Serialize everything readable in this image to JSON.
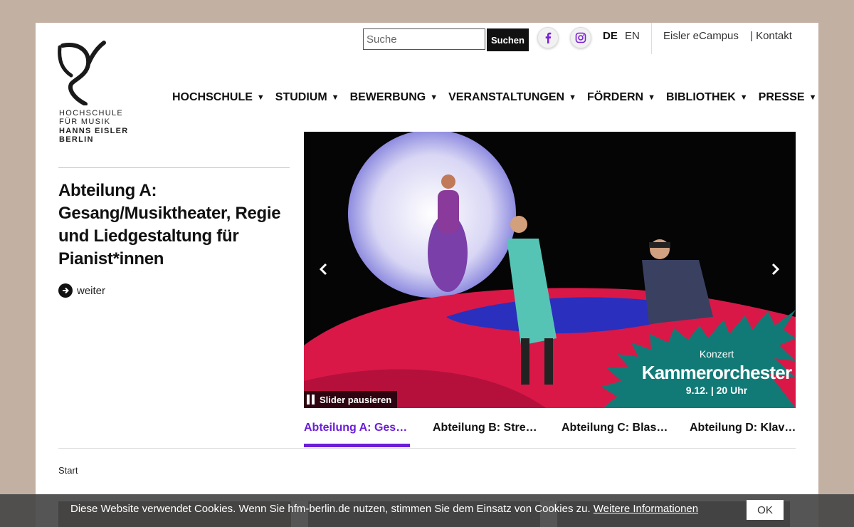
{
  "header": {
    "search": {
      "placeholder": "Suche",
      "value": "",
      "button": "Suchen"
    },
    "social": [
      "facebook-icon",
      "instagram-icon"
    ],
    "languages": [
      {
        "label": "DE",
        "active": true
      },
      {
        "label": "EN",
        "active": false
      }
    ],
    "links": [
      "Eisler eCampus",
      "| Kontakt"
    ]
  },
  "logo": {
    "line1": "HOCHSCHULE",
    "line2": "FÜR MUSIK",
    "line3": "HANNS EISLER",
    "line4": "BERLIN"
  },
  "nav": [
    "HOCHSCHULE",
    "STUDIUM",
    "BEWERBUNG",
    "VERANSTALTUNGEN",
    "FÖRDERN",
    "BIBLIOTHEK",
    "PRESSE"
  ],
  "teaser": {
    "title": "Abteilung A: Gesang/Musiktheater, Regie und Liedgestaltung für Pianist*innen",
    "more": "weiter"
  },
  "slider": {
    "pause_label": "Slider pausieren",
    "badge": {
      "kicker": "Konzert",
      "title": "Kammerorchester",
      "date": "9.12. | 20 Uhr"
    },
    "colors": {
      "badge": "#127a76",
      "stage": "#e0204f",
      "accent": "#6b1fd6"
    }
  },
  "tabs": [
    {
      "label": "Abteilung A: Ges…",
      "active": true
    },
    {
      "label": "Abteilung B: Stre…",
      "active": false
    },
    {
      "label": "Abteilung C: Blas…",
      "active": false
    },
    {
      "label": "Abteilung D: Klav…",
      "active": false
    }
  ],
  "breadcrumb": "Start",
  "cookie": {
    "text": "Diese Website verwendet Cookies. Wenn Sie hfm-berlin.de nutzen, stimmen Sie dem Einsatz von Cookies zu. ",
    "link": "Weitere Informationen",
    "ok": "OK"
  }
}
